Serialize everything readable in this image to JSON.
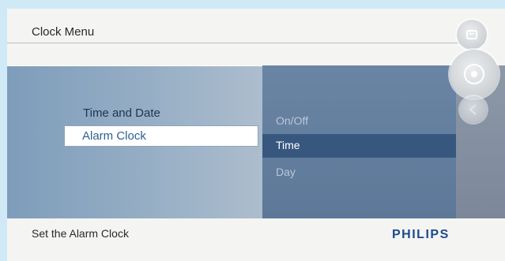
{
  "header": {
    "title": "Clock Menu"
  },
  "menu": {
    "items": [
      {
        "label": "Time and Date"
      },
      {
        "label": "Alarm Clock"
      }
    ]
  },
  "submenu": {
    "items": [
      {
        "label": "On/Off"
      },
      {
        "label": "Time"
      },
      {
        "label": "Day"
      }
    ]
  },
  "footer": {
    "hint": "Set the Alarm Clock",
    "brand": "PHILIPS"
  },
  "colors": {
    "selected_text": "#2d5f94",
    "submenu_highlight": "#38577f",
    "brand": "#1c4a8c"
  },
  "icons": [
    "menu-icon",
    "navigation-dial-icon",
    "back-icon"
  ]
}
